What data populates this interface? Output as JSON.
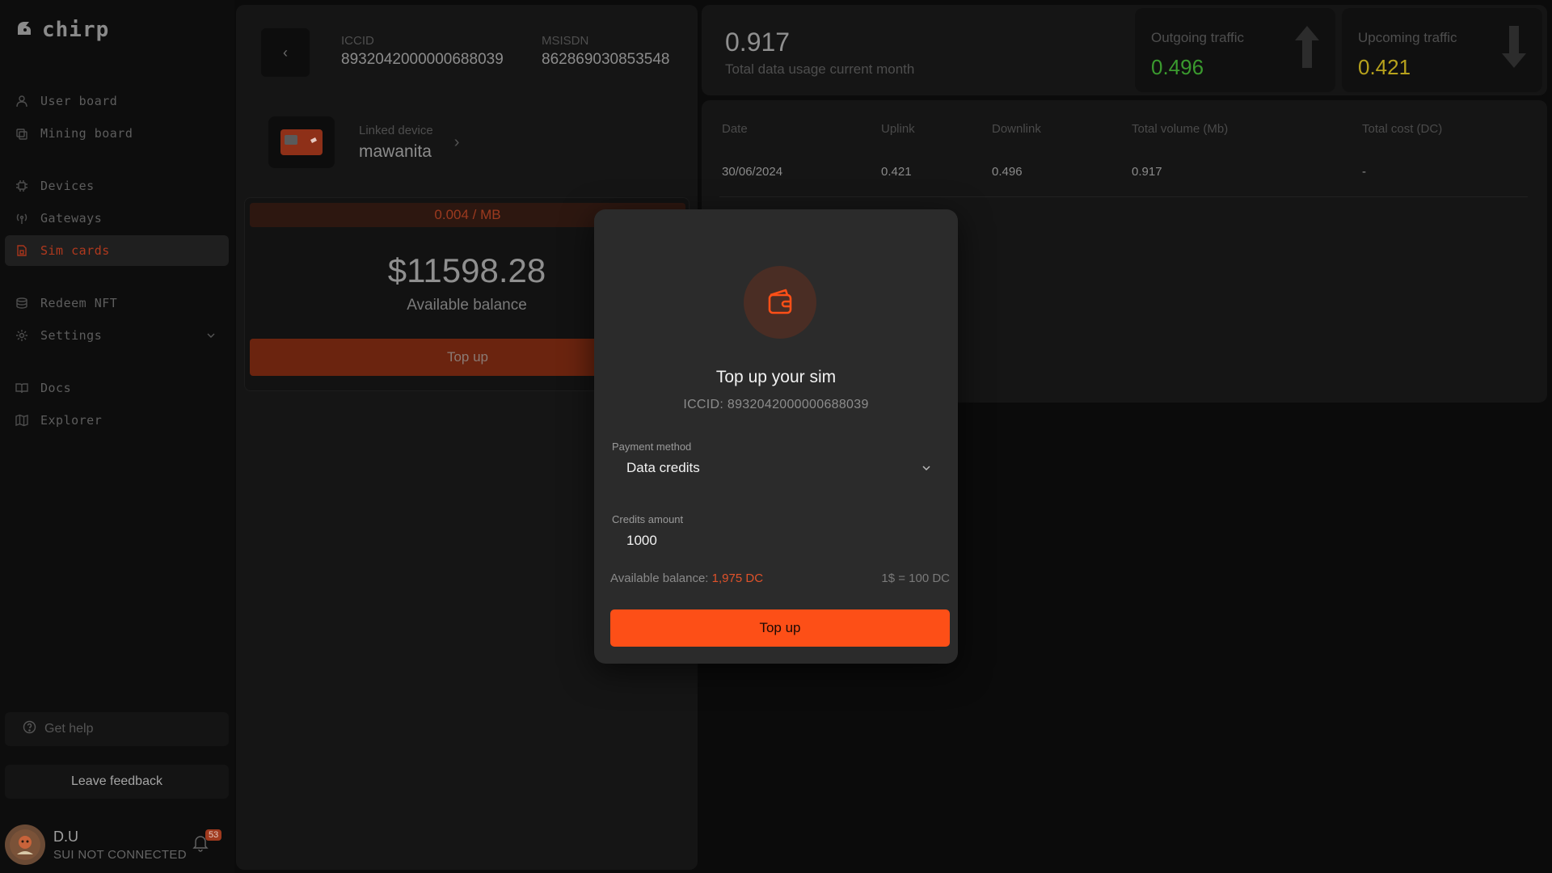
{
  "app": {
    "logo_text": "chirp"
  },
  "sidebar": {
    "items": [
      {
        "label": "User board",
        "icon": "user-icon"
      },
      {
        "label": "Mining board",
        "icon": "mining-icon"
      },
      {
        "label": "Devices",
        "icon": "chip-icon"
      },
      {
        "label": "Gateways",
        "icon": "antenna-icon"
      },
      {
        "label": "Sim cards",
        "icon": "sim-icon",
        "active": true
      },
      {
        "label": "Redeem NFT",
        "icon": "nft-icon"
      },
      {
        "label": "Settings",
        "icon": "gear-icon"
      },
      {
        "label": "Docs",
        "icon": "book-icon"
      },
      {
        "label": "Explorer",
        "icon": "map-icon"
      }
    ],
    "get_help": "Get help",
    "leave_feedback": "Leave feedback",
    "user": {
      "name": "D.U",
      "status": "SUI NOT CONNECTED",
      "notifications": "53"
    }
  },
  "sim": {
    "iccid_label": "ICCID",
    "iccid": "8932042000000688039",
    "msisdn_label": "MSISDN",
    "msisdn": "862869030853548",
    "linked_device_label": "Linked device",
    "linked_device": "mawanita",
    "rate": "0.004 / MB",
    "balance": "$11598.28",
    "balance_label": "Available balance",
    "topup_label": "Top up"
  },
  "stats": {
    "total": "0.917",
    "total_label": "Total data usage current month",
    "outgoing_label": "Outgoing traffic",
    "outgoing": "0.496",
    "upcoming_label": "Upcoming traffic",
    "upcoming": "0.421",
    "colors": {
      "outgoing": "#3a9a2e",
      "upcoming": "#b7a21c"
    }
  },
  "table": {
    "headers": [
      "Date",
      "Uplink",
      "Downlink",
      "Total volume (Mb)",
      "Total cost (DC)"
    ],
    "rows": [
      [
        "30/06/2024",
        "0.421",
        "0.496",
        "0.917",
        "-"
      ]
    ]
  },
  "modal": {
    "title": "Top up your sim",
    "subtitle": "ICCID: 8932042000000688039",
    "payment_label": "Payment method",
    "payment_value": "Data credits",
    "credits_label": "Credits amount",
    "credits_value": "1000",
    "available_prefix": "Available balance: ",
    "available_value": "1,975 DC",
    "conversion": "1$ = 100 DC",
    "button": "Top up",
    "accent": "#fd4f17"
  }
}
